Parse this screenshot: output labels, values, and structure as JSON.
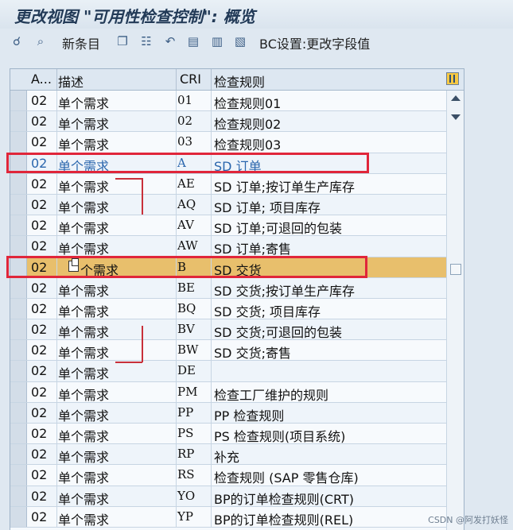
{
  "title": "更改视图 \"可用性检查控制\": 概览",
  "toolbar": {
    "new_entries": "新条目",
    "bc_settings": "BC设置:更改字段值"
  },
  "columns": [
    "A...",
    "描述",
    "CRI",
    "检查规则"
  ],
  "rows": [
    {
      "a": "02",
      "desc": "单个需求",
      "cri": "01",
      "rule": "检查规则01"
    },
    {
      "a": "02",
      "desc": "单个需求",
      "cri": "02",
      "rule": "检查规则02"
    },
    {
      "a": "02",
      "desc": "单个需求",
      "cri": "03",
      "rule": "检查规则03"
    },
    {
      "a": "02",
      "desc": "单个需求",
      "cri": "A",
      "rule": "SD 订单"
    },
    {
      "a": "02",
      "desc": "单个需求",
      "cri": "AE",
      "rule": "SD 订单;按订单生产库存"
    },
    {
      "a": "02",
      "desc": "单个需求",
      "cri": "AQ",
      "rule": "SD 订单; 项目库存"
    },
    {
      "a": "02",
      "desc": "单个需求",
      "cri": "AV",
      "rule": "SD 订单;可退回的包装"
    },
    {
      "a": "02",
      "desc": "单个需求",
      "cri": "AW",
      "rule": "SD 订单;寄售"
    },
    {
      "a": "02",
      "desc": "个需求",
      "cri": "B",
      "rule": "SD 交货"
    },
    {
      "a": "02",
      "desc": "单个需求",
      "cri": "BE",
      "rule": "SD 交货;按订单生产库存"
    },
    {
      "a": "02",
      "desc": "单个需求",
      "cri": "BQ",
      "rule": "SD 交货; 项目库存"
    },
    {
      "a": "02",
      "desc": "单个需求",
      "cri": "BV",
      "rule": "SD 交货;可退回的包装"
    },
    {
      "a": "02",
      "desc": "单个需求",
      "cri": "BW",
      "rule": "SD 交货;寄售"
    },
    {
      "a": "02",
      "desc": "单个需求",
      "cri": "DE",
      "rule": ""
    },
    {
      "a": "02",
      "desc": "单个需求",
      "cri": "PM",
      "rule": "检查工厂维护的规则"
    },
    {
      "a": "02",
      "desc": "单个需求",
      "cri": "PP",
      "rule": "PP 检查规则"
    },
    {
      "a": "02",
      "desc": "单个需求",
      "cri": "PS",
      "rule": "PS 检查规则(项目系统)"
    },
    {
      "a": "02",
      "desc": "单个需求",
      "cri": "RP",
      "rule": "补充"
    },
    {
      "a": "02",
      "desc": "单个需求",
      "cri": "RS",
      "rule": "检查规则 (SAP 零售仓库)"
    },
    {
      "a": "02",
      "desc": "单个需求",
      "cri": "YO",
      "rule": "BP的订单检查规则(CRT)"
    },
    {
      "a": "02",
      "desc": "单个需求",
      "cri": "YP",
      "rule": "BP的订单检查规则(REL)"
    }
  ],
  "highlighted_row": 3,
  "selected_row": 8,
  "icons": {
    "toolbar": [
      "glasses-icon",
      "find-icon",
      "copy-icon",
      "delete-icon",
      "undo-icon",
      "select-all-icon",
      "select-block-icon",
      "deselect-all-icon"
    ],
    "column_config": "column-settings-icon"
  },
  "colors": {
    "selected_row": "#e8bf6c",
    "highlight_text": "#2a66ad",
    "annotation_red": "#e0263a"
  },
  "watermark": "CSDN @阿发打妖怪"
}
